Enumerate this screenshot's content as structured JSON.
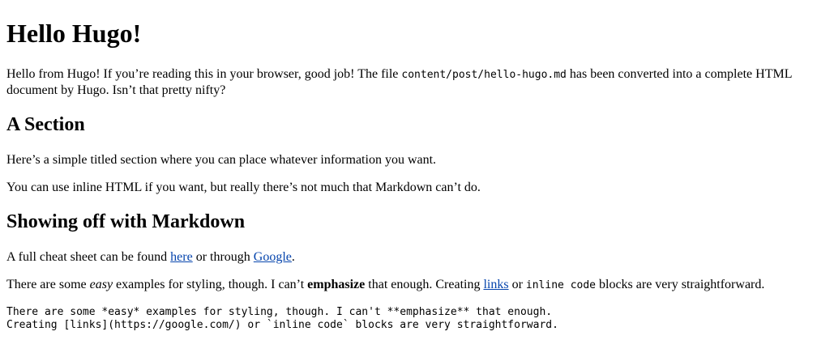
{
  "title": "Hello Hugo!",
  "intro": {
    "before_code": "Hello from Hugo! If you’re reading this in your browser, good job! The file ",
    "code": "content/post/hello-hugo.md",
    "after_code": " has been converted into a complete HTML document by Hugo. Isn’t that pretty nifty?"
  },
  "section": {
    "heading": "A Section",
    "p1": "Here’s a simple titled section where you can place whatever information you want.",
    "p2": "You can use inline HTML if you want, but really there’s not much that Markdown can’t do."
  },
  "markdown_section": {
    "heading": "Showing off with Markdown",
    "cheat_before": "A full cheat sheet can be found ",
    "cheat_link_here": "here",
    "cheat_middle": " or through ",
    "cheat_link_google": "Google",
    "cheat_after": ".",
    "easy_p": {
      "t1": "There are some ",
      "em": "easy",
      "t2": " examples for styling, though. I can’t ",
      "strong": "emphasize",
      "t3": " that enough. Creating ",
      "link": "links",
      "t4": " or ",
      "code": "inline code",
      "t5": " blocks are very straightforward."
    },
    "code_block": {
      "line1": "There are some *easy* examples for styling, though. I can't **emphasize** that enough.",
      "line2": "Creating [links](https://google.com/) or `inline code` blocks are very straightforward."
    }
  }
}
